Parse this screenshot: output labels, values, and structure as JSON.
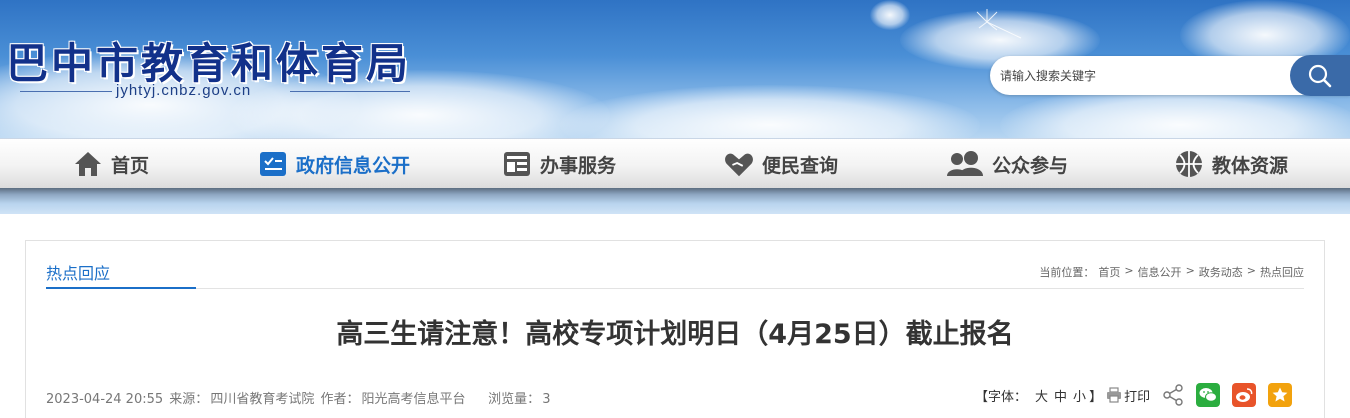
{
  "header": {
    "site_title": "巴中市教育和体育局",
    "site_domain": "jyhtyj.cnbz.gov.cn",
    "search_placeholder": "请输入搜索关键字"
  },
  "nav": {
    "items": [
      {
        "label": "首页",
        "icon": "home-icon"
      },
      {
        "label": "政府信息公开",
        "icon": "info-public-icon"
      },
      {
        "label": "办事服务",
        "icon": "service-icon"
      },
      {
        "label": "便民查询",
        "icon": "heart-hand-icon"
      },
      {
        "label": "公众参与",
        "icon": "people-icon"
      },
      {
        "label": "教体资源",
        "icon": "ball-icon"
      }
    ],
    "active_index": 1
  },
  "section": {
    "title": "热点回应",
    "breadcrumb_prefix": "当前位置：",
    "breadcrumb": [
      "首页",
      "信息公开",
      "政务动态",
      "热点回应"
    ],
    "sep": ">"
  },
  "article": {
    "title": "高三生请注意！高校专项计划明日（4月25日）截止报名",
    "datetime": "2023-04-24 20:55",
    "source_label": "来源：",
    "source": "四川省教育考试院",
    "author_label": "作者：",
    "author": "阳光高考信息平台",
    "views_label": "浏览量：",
    "views": "3"
  },
  "tools": {
    "font_label": "【字体：",
    "font_large": "大",
    "font_medium": "中",
    "font_small": "小",
    "font_close": "】",
    "print_label": "打印"
  },
  "colors": {
    "accent": "#1b6fc8",
    "title_blue": "#12318a",
    "wechat": "#2bad3f",
    "weibo": "#e8542a",
    "favorite": "#f2a20d"
  }
}
